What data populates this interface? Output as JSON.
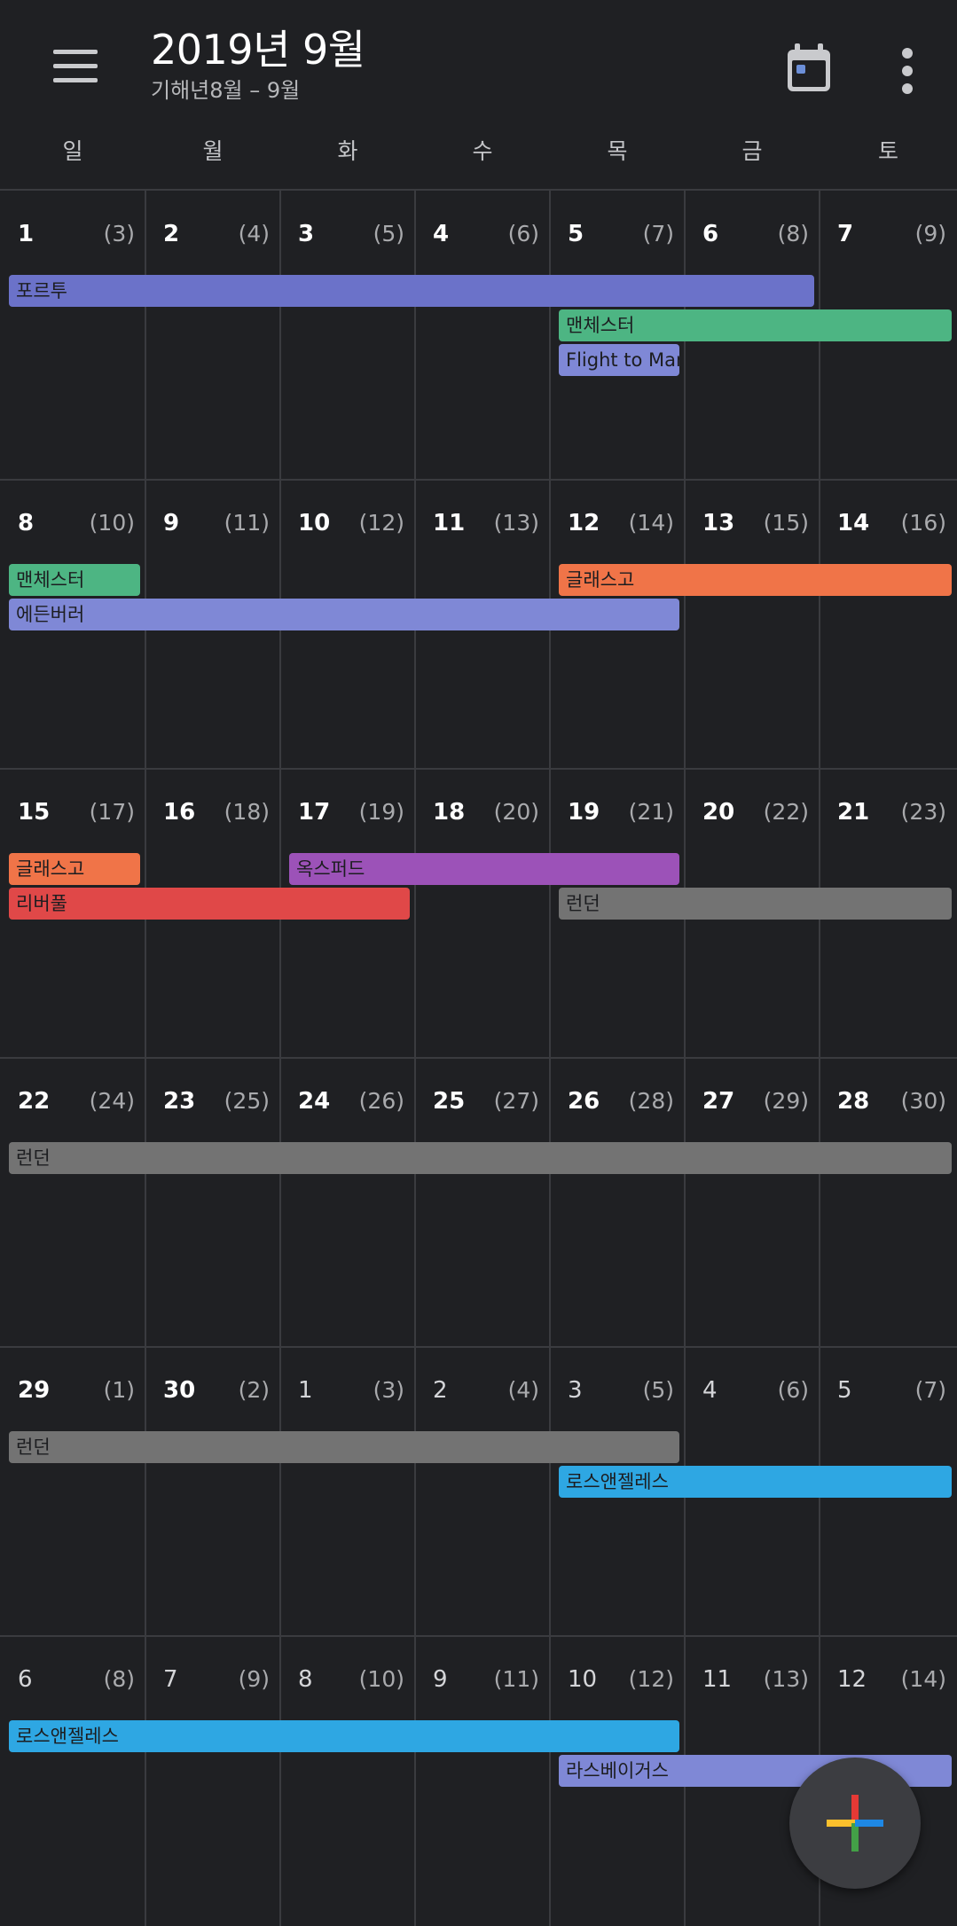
{
  "header": {
    "title": "2019년 9월",
    "subtitle": "기해년8월 – 9월",
    "menu_icon": "hamburger-menu-icon",
    "today_icon": "calendar-today-icon",
    "more_icon": "more-vert-icon"
  },
  "weekdays": [
    "일",
    "월",
    "화",
    "수",
    "목",
    "금",
    "토"
  ],
  "weeks": [
    {
      "days": [
        {
          "day": "1",
          "lunar": "(3)",
          "current": true
        },
        {
          "day": "2",
          "lunar": "(4)",
          "current": true
        },
        {
          "day": "3",
          "lunar": "(5)",
          "current": true
        },
        {
          "day": "4",
          "lunar": "(6)",
          "current": true
        },
        {
          "day": "5",
          "lunar": "(7)",
          "current": true
        },
        {
          "day": "6",
          "lunar": "(8)",
          "current": true
        },
        {
          "day": "7",
          "lunar": "(9)",
          "current": true
        }
      ],
      "events": [
        {
          "title": "포르투",
          "start": 0,
          "span": 6,
          "row": 0,
          "color": "#6b72c9"
        },
        {
          "title": "맨체스터",
          "start": 4,
          "span": 3,
          "row": 1,
          "color": "#4db583"
        },
        {
          "title": "Flight to Manchester",
          "start": 4,
          "span": 1,
          "row": 2,
          "color": "#7f88d6"
        }
      ]
    },
    {
      "days": [
        {
          "day": "8",
          "lunar": "(10)",
          "current": true
        },
        {
          "day": "9",
          "lunar": "(11)",
          "current": true
        },
        {
          "day": "10",
          "lunar": "(12)",
          "current": true
        },
        {
          "day": "11",
          "lunar": "(13)",
          "current": true
        },
        {
          "day": "12",
          "lunar": "(14)",
          "current": true
        },
        {
          "day": "13",
          "lunar": "(15)",
          "current": true
        },
        {
          "day": "14",
          "lunar": "(16)",
          "current": true
        }
      ],
      "events": [
        {
          "title": "맨체스터",
          "start": 0,
          "span": 1,
          "row": 0,
          "color": "#4db583"
        },
        {
          "title": "글래스고",
          "start": 4,
          "span": 3,
          "row": 0,
          "color": "#f07448"
        },
        {
          "title": "에든버러",
          "start": 0,
          "span": 5,
          "row": 1,
          "color": "#7f88d6"
        }
      ]
    },
    {
      "days": [
        {
          "day": "15",
          "lunar": "(17)",
          "current": true
        },
        {
          "day": "16",
          "lunar": "(18)",
          "current": true
        },
        {
          "day": "17",
          "lunar": "(19)",
          "current": true
        },
        {
          "day": "18",
          "lunar": "(20)",
          "current": true
        },
        {
          "day": "19",
          "lunar": "(21)",
          "current": true
        },
        {
          "day": "20",
          "lunar": "(22)",
          "current": true
        },
        {
          "day": "21",
          "lunar": "(23)",
          "current": true
        }
      ],
      "events": [
        {
          "title": "글래스고",
          "start": 0,
          "span": 1,
          "row": 0,
          "color": "#f07448"
        },
        {
          "title": "옥스퍼드",
          "start": 2,
          "span": 3,
          "row": 0,
          "color": "#9c52b8"
        },
        {
          "title": "리버풀",
          "start": 0,
          "span": 3,
          "row": 1,
          "color": "#e04848"
        },
        {
          "title": "런던",
          "start": 4,
          "span": 3,
          "row": 1,
          "color": "#737373"
        }
      ]
    },
    {
      "days": [
        {
          "day": "22",
          "lunar": "(24)",
          "current": true
        },
        {
          "day": "23",
          "lunar": "(25)",
          "current": true
        },
        {
          "day": "24",
          "lunar": "(26)",
          "current": true
        },
        {
          "day": "25",
          "lunar": "(27)",
          "current": true
        },
        {
          "day": "26",
          "lunar": "(28)",
          "current": true
        },
        {
          "day": "27",
          "lunar": "(29)",
          "current": true
        },
        {
          "day": "28",
          "lunar": "(30)",
          "current": true
        }
      ],
      "events": [
        {
          "title": "런던",
          "start": 0,
          "span": 7,
          "row": 0,
          "color": "#737373"
        }
      ]
    },
    {
      "days": [
        {
          "day": "29",
          "lunar": "(1)",
          "current": true
        },
        {
          "day": "30",
          "lunar": "(2)",
          "current": true
        },
        {
          "day": "1",
          "lunar": "(3)",
          "current": false
        },
        {
          "day": "2",
          "lunar": "(4)",
          "current": false
        },
        {
          "day": "3",
          "lunar": "(5)",
          "current": false
        },
        {
          "day": "4",
          "lunar": "(6)",
          "current": false
        },
        {
          "day": "5",
          "lunar": "(7)",
          "current": false
        }
      ],
      "events": [
        {
          "title": "런던",
          "start": 0,
          "span": 5,
          "row": 0,
          "color": "#737373"
        },
        {
          "title": "로스앤젤레스",
          "start": 4,
          "span": 3,
          "row": 1,
          "color": "#2ea7e3"
        }
      ]
    },
    {
      "days": [
        {
          "day": "6",
          "lunar": "(8)",
          "current": false
        },
        {
          "day": "7",
          "lunar": "(9)",
          "current": false
        },
        {
          "day": "8",
          "lunar": "(10)",
          "current": false
        },
        {
          "day": "9",
          "lunar": "(11)",
          "current": false
        },
        {
          "day": "10",
          "lunar": "(12)",
          "current": false
        },
        {
          "day": "11",
          "lunar": "(13)",
          "current": false
        },
        {
          "day": "12",
          "lunar": "(14)",
          "current": false
        }
      ],
      "events": [
        {
          "title": "로스앤젤레스",
          "start": 0,
          "span": 5,
          "row": 0,
          "color": "#2ea7e3"
        },
        {
          "title": "라스베이거스",
          "start": 4,
          "span": 3,
          "row": 1,
          "color": "#7f88d6"
        }
      ]
    }
  ],
  "fab": {
    "icon": "add-event-plus-icon",
    "colors": [
      "#e53935",
      "#fbc02d",
      "#43a047",
      "#1e88e5"
    ]
  }
}
